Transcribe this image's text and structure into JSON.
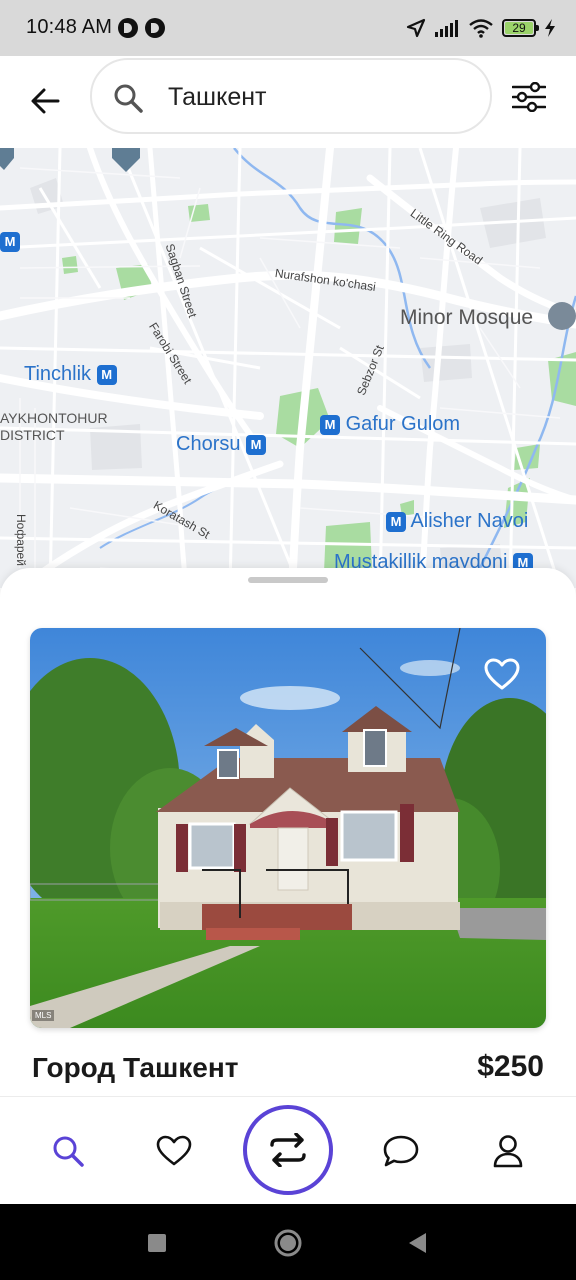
{
  "status_bar": {
    "time": "10:48 AM",
    "battery_level": "29",
    "icons": [
      "notification-dot-icon",
      "notification-dot-icon",
      "location-arrow-icon",
      "signal-icon",
      "wifi-icon",
      "battery-icon",
      "charging-bolt-icon"
    ]
  },
  "header": {
    "back_icon": "arrow-left-icon",
    "search_icon": "search-icon",
    "search_value": "Ташкент",
    "filter_icon": "sliders-icon"
  },
  "map": {
    "stations": [
      "Tinchlik",
      "Chorsu",
      "Gafur Gulom",
      "Alisher Navoi",
      "Mustakillik maydoni"
    ],
    "streets": [
      "Sagban Street",
      "Nurafshon ko'chasi",
      "Little Ring Road",
      "Farobi Street",
      "Sebzor St",
      "Koratash St",
      "Нофарей"
    ],
    "district": "AYKHONTOHUR\nDISTRICT",
    "poi": "Minor Mosque",
    "metro_symbol": "M"
  },
  "listing": {
    "title": "Город Ташкент",
    "price": "$250",
    "photo_badge": "MLS",
    "favorite_icon": "heart-outline-icon"
  },
  "bottom_nav": {
    "items": [
      {
        "name": "search",
        "icon": "search-icon",
        "active": true
      },
      {
        "name": "favorites",
        "icon": "heart-icon",
        "active": false
      },
      {
        "name": "swap",
        "icon": "swap-arrows-icon",
        "active": false
      },
      {
        "name": "messages",
        "icon": "chat-bubble-icon",
        "active": false
      },
      {
        "name": "profile",
        "icon": "user-icon",
        "active": false
      }
    ]
  },
  "colors": {
    "accent": "#5a43d6",
    "status_bar_bg": "#d9d9d9",
    "map_bg": "#eef0f3",
    "park": "#a9dca1",
    "water": "#8fb8f0",
    "metro": "#1e6fd0"
  }
}
